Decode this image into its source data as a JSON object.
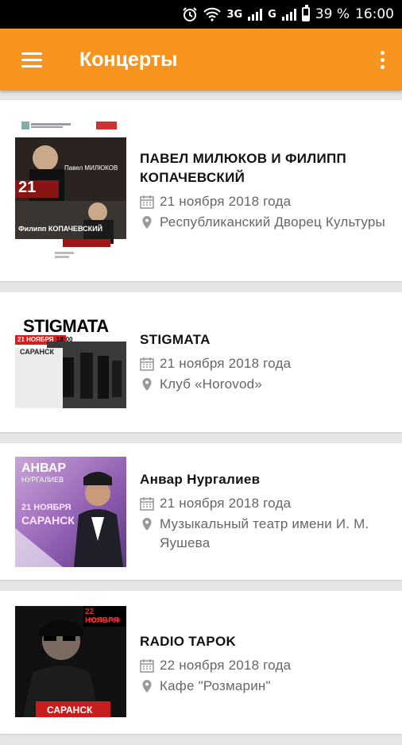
{
  "status_bar": {
    "network_1": "3G",
    "network_2": "G",
    "battery": "39 %",
    "time": "16:00"
  },
  "app_bar": {
    "title": "Концерты",
    "menu_icon": "hamburger-menu-icon",
    "overflow_icon": "more-vert-icon"
  },
  "concerts": [
    {
      "name": "ПАВЕЛ МИЛЮКОВ И ФИЛИПП КОПАЧЕВСКИЙ",
      "date": "21 ноября 2018 года",
      "venue": "Республиканский Дворец Культуры",
      "poster_text": [
        "21",
        "Павел МИЛЮКОВ",
        "Филипп КОПАЧЕВСКИЙ"
      ]
    },
    {
      "name": "STIGMATA",
      "date": "21 ноября 2018 года",
      "venue": "Клуб «Horovod»",
      "poster_text": [
        "STIGMATA",
        "21 НОЯБРЯ",
        "18:00",
        "САРАНСК"
      ]
    },
    {
      "name": "Анвар Нургалиев",
      "date": "21 ноября 2018 года",
      "venue": "Музыкальный театр имени И. М. Яушева",
      "poster_text": [
        "АНВАР",
        "НУРГАЛИЕВ",
        "21 НОЯБРЯ",
        "САРАНСК"
      ]
    },
    {
      "name": "RADIO TAPOK",
      "date": "22 ноября 2018 года",
      "venue": "Кафе \"Розмарин\"",
      "poster_text": [
        "22 НОЯБРЯ",
        "РОЗМАРИН",
        "САРАНСК"
      ]
    }
  ],
  "colors": {
    "accent": "#f7941d",
    "background": "#e6e6e6"
  }
}
